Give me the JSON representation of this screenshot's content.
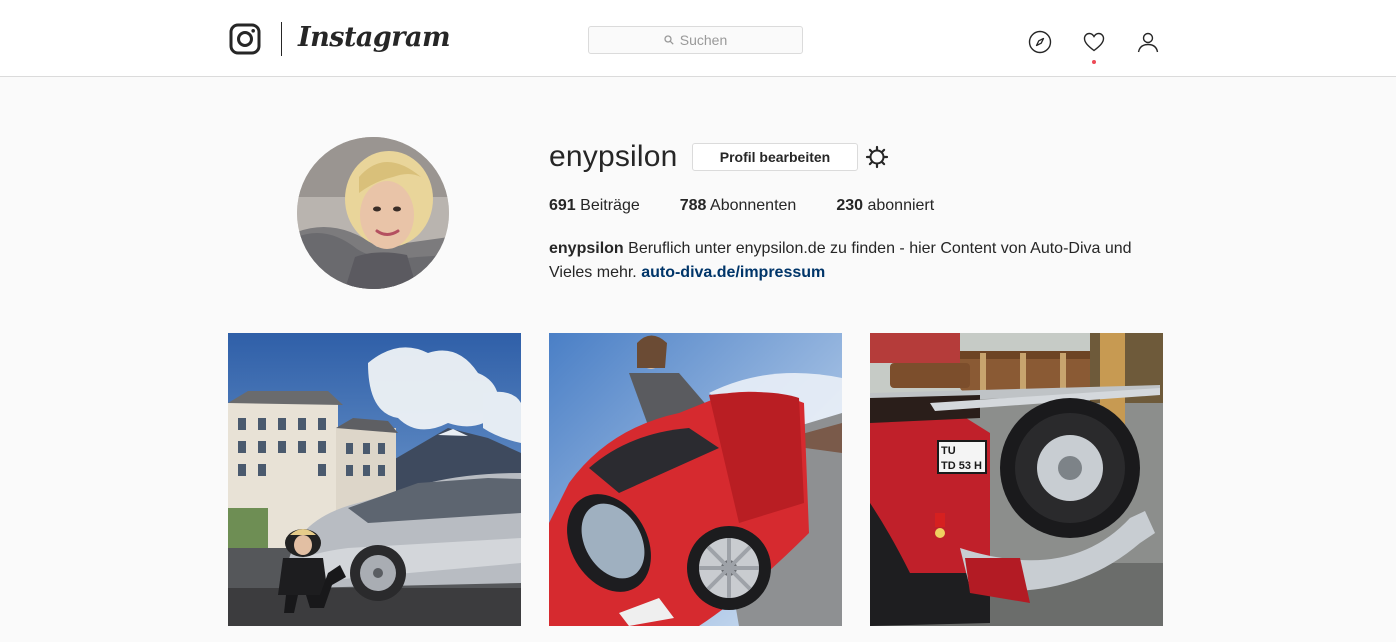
{
  "app": {
    "wordmark": "Instagram"
  },
  "search": {
    "placeholder": "Suchen"
  },
  "nav": {
    "icons": [
      "compass-icon",
      "heart-icon",
      "person-icon"
    ]
  },
  "profile": {
    "username": "enypsilon",
    "edit_label": "Profil bearbeiten",
    "stats": [
      {
        "count": "691",
        "label": "Beiträge"
      },
      {
        "count": "788",
        "label": "Abonnenten"
      },
      {
        "count": "230",
        "label": "abonniert"
      }
    ],
    "bio": {
      "name": "enypsilon",
      "text": "Beruflich unter enypsilon.de zu finden - hier Content von Auto-Diva und Vieles mehr.",
      "link": "auto-diva.de/impressum"
    }
  },
  "posts": [
    {
      "subject": "woman-with-silver-mercedes"
    },
    {
      "subject": "woman-with-red-porsche"
    },
    {
      "subject": "red-vintage-car-with-luggage"
    }
  ],
  "plates": {
    "vintage_car": "TD 53 H",
    "canton": "TU"
  },
  "colors": {
    "accent_link": "#003569",
    "notification": "#ed4956",
    "border": "#dbdbdb"
  }
}
